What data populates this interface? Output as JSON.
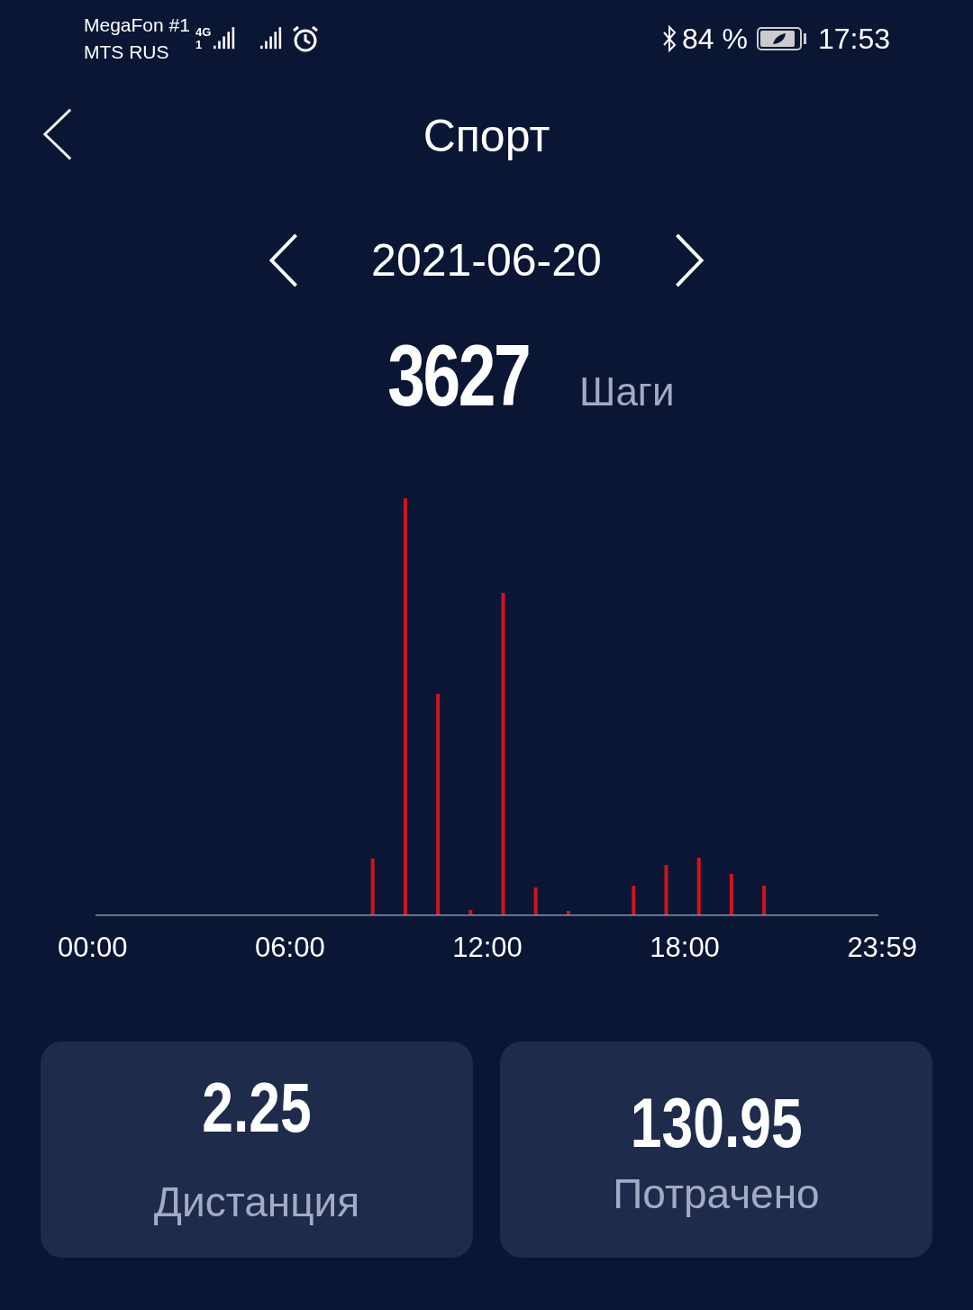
{
  "status_bar": {
    "carrier_1": "MegaFon #1",
    "carrier_2": "MTS RUS",
    "network": "4G",
    "sim": "1",
    "battery": "84 %",
    "time": "17:53"
  },
  "header": {
    "title": "Спорт"
  },
  "date_nav": {
    "date": "2021-06-20"
  },
  "steps": {
    "value": "3627",
    "unit": "Шаги"
  },
  "chart": {
    "x_labels": [
      "00:00",
      "06:00",
      "12:00",
      "18:00",
      "23:59"
    ]
  },
  "cards": [
    {
      "value": "2.25",
      "label": "Дистанция"
    },
    {
      "value": "130.95",
      "label": "Потрачено"
    }
  ]
}
